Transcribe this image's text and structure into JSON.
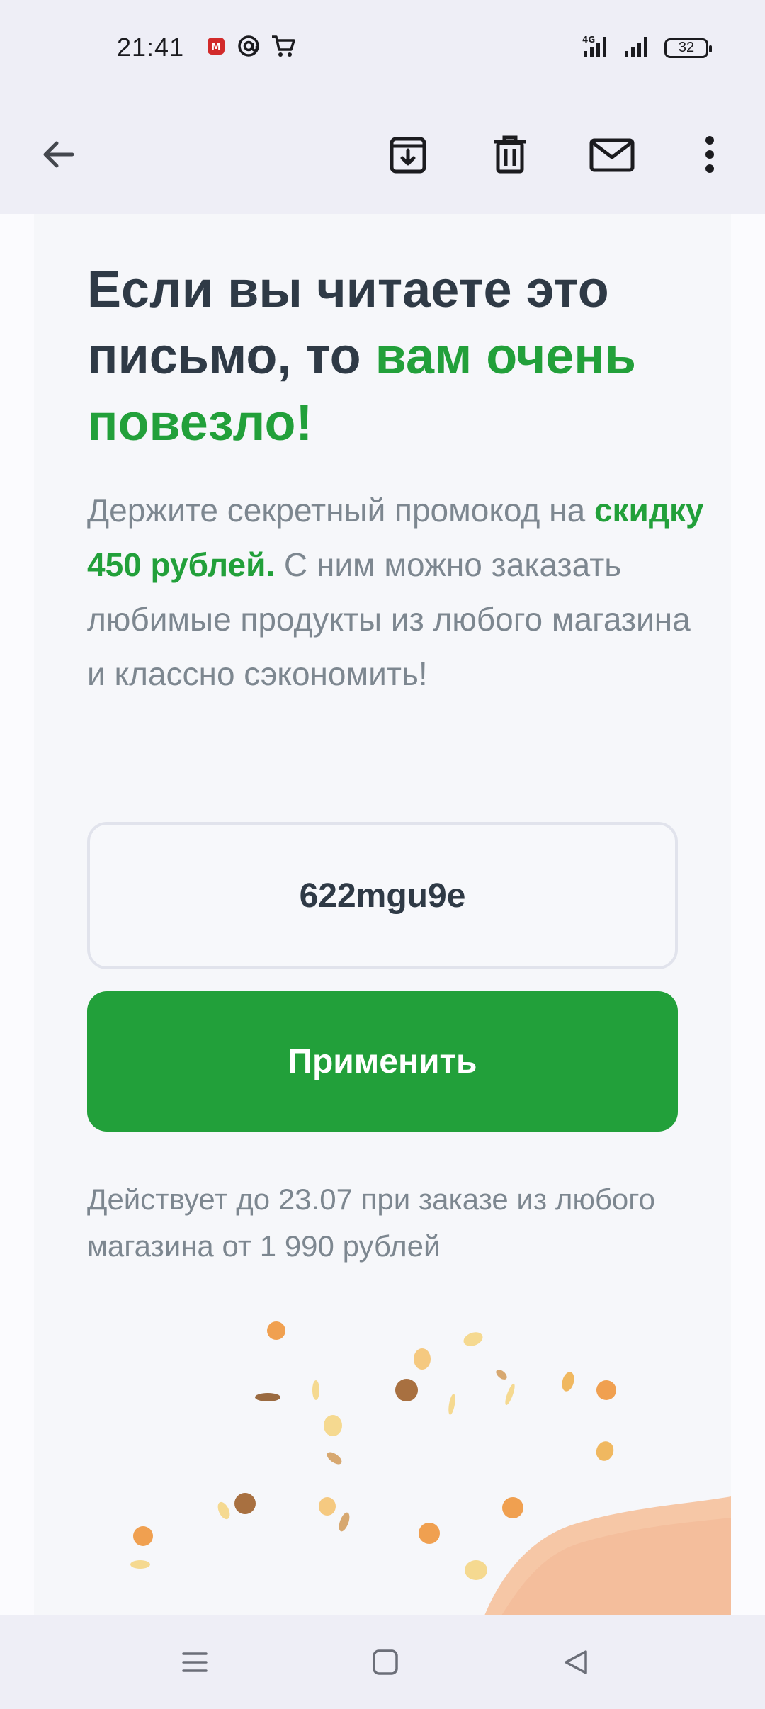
{
  "status_bar": {
    "time": "21:41",
    "notification_icons": [
      "app-notification-icon",
      "at-sign-icon",
      "cart-icon"
    ],
    "network": "4G",
    "battery": "32"
  },
  "toolbar": {
    "back": "back-arrow-icon",
    "actions": [
      "archive-icon",
      "trash-icon",
      "mail-icon",
      "more-vert-icon"
    ]
  },
  "email": {
    "headline_part1": "Если вы читаете это письмо, то ",
    "headline_highlight": "вам очень повезло!",
    "body_part1": "Держите секретный промокод на ",
    "body_highlight": "скидку 450 рублей.",
    "body_part2": " С ним можно заказать любимые продукты из любого магазина и классно сэкономить!",
    "promo_code": "622mgu9e",
    "apply_label": "Применить",
    "terms": "Действует до 23.07 при заказе из любого магазина от 1 990 рублей"
  },
  "colors": {
    "accent_green": "#22a03a",
    "heading": "#2f3a46",
    "body_text": "#7d8790"
  },
  "nav_bar": {
    "buttons": [
      "menu-icon",
      "home-icon",
      "back-triangle-icon"
    ]
  }
}
